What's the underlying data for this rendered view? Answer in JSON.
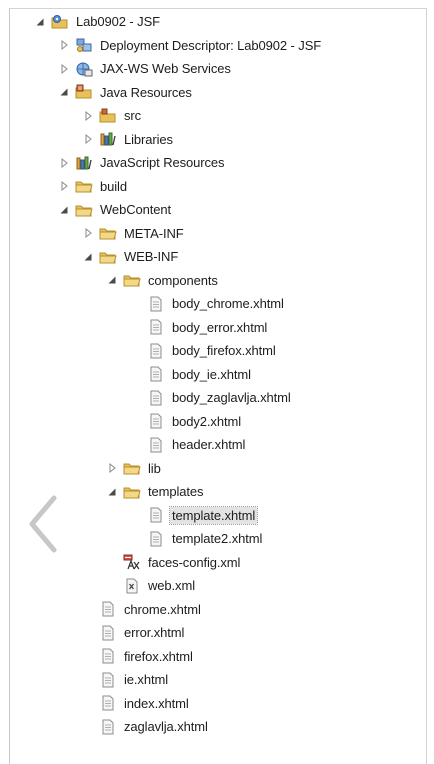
{
  "tree": [
    {
      "label": "Lab0902 - JSF",
      "depth": 0,
      "twisty": "expanded",
      "icon": "project-icon"
    },
    {
      "label": "Deployment Descriptor: Lab0902 - JSF",
      "depth": 1,
      "twisty": "collapsed",
      "icon": "deployment-descriptor-icon"
    },
    {
      "label": "JAX-WS Web Services",
      "depth": 1,
      "twisty": "collapsed",
      "icon": "web-services-icon"
    },
    {
      "label": "Java Resources",
      "depth": 1,
      "twisty": "expanded",
      "icon": "java-resources-icon"
    },
    {
      "label": "src",
      "depth": 2,
      "twisty": "collapsed",
      "icon": "source-folder-icon"
    },
    {
      "label": "Libraries",
      "depth": 2,
      "twisty": "collapsed",
      "icon": "libraries-icon"
    },
    {
      "label": "JavaScript Resources",
      "depth": 1,
      "twisty": "collapsed",
      "icon": "javascript-resources-icon"
    },
    {
      "label": "build",
      "depth": 1,
      "twisty": "collapsed",
      "icon": "folder-icon"
    },
    {
      "label": "WebContent",
      "depth": 1,
      "twisty": "expanded",
      "icon": "folder-icon"
    },
    {
      "label": "META-INF",
      "depth": 2,
      "twisty": "collapsed",
      "icon": "folder-icon"
    },
    {
      "label": "WEB-INF",
      "depth": 2,
      "twisty": "expanded",
      "icon": "folder-icon"
    },
    {
      "label": "components",
      "depth": 3,
      "twisty": "expanded",
      "icon": "folder-icon"
    },
    {
      "label": "body_chrome.xhtml",
      "depth": 4,
      "twisty": "none",
      "icon": "xhtml-file-icon"
    },
    {
      "label": "body_error.xhtml",
      "depth": 4,
      "twisty": "none",
      "icon": "xhtml-file-icon"
    },
    {
      "label": "body_firefox.xhtml",
      "depth": 4,
      "twisty": "none",
      "icon": "xhtml-file-icon"
    },
    {
      "label": "body_ie.xhtml",
      "depth": 4,
      "twisty": "none",
      "icon": "xhtml-file-icon"
    },
    {
      "label": "body_zaglavlja.xhtml",
      "depth": 4,
      "twisty": "none",
      "icon": "xhtml-file-icon"
    },
    {
      "label": "body2.xhtml",
      "depth": 4,
      "twisty": "none",
      "icon": "xhtml-file-icon"
    },
    {
      "label": "header.xhtml",
      "depth": 4,
      "twisty": "none",
      "icon": "xhtml-file-icon"
    },
    {
      "label": "lib",
      "depth": 3,
      "twisty": "collapsed",
      "icon": "folder-icon"
    },
    {
      "label": "templates",
      "depth": 3,
      "twisty": "expanded",
      "icon": "folder-icon"
    },
    {
      "label": "template.xhtml",
      "depth": 4,
      "twisty": "none",
      "icon": "xhtml-file-icon",
      "selected": true
    },
    {
      "label": "template2.xhtml",
      "depth": 4,
      "twisty": "none",
      "icon": "xhtml-file-icon"
    },
    {
      "label": "faces-config.xml",
      "depth": 3,
      "twisty": "none",
      "icon": "faces-config-icon"
    },
    {
      "label": "web.xml",
      "depth": 3,
      "twisty": "none",
      "icon": "xml-file-icon"
    },
    {
      "label": "chrome.xhtml",
      "depth": 2,
      "twisty": "none",
      "icon": "xhtml-file-icon"
    },
    {
      "label": "error.xhtml",
      "depth": 2,
      "twisty": "none",
      "icon": "xhtml-file-icon"
    },
    {
      "label": "firefox.xhtml",
      "depth": 2,
      "twisty": "none",
      "icon": "xhtml-file-icon"
    },
    {
      "label": "ie.xhtml",
      "depth": 2,
      "twisty": "none",
      "icon": "xhtml-file-icon"
    },
    {
      "label": "index.xhtml",
      "depth": 2,
      "twisty": "none",
      "icon": "xhtml-file-icon"
    },
    {
      "label": "zaglavlja.xhtml",
      "depth": 2,
      "twisty": "none",
      "icon": "xhtml-file-icon"
    }
  ],
  "colors": {
    "folder": "#e8c15a",
    "folder_stroke": "#b8902a",
    "selection": "#e3e3e3",
    "text": "#1d1d1d"
  }
}
